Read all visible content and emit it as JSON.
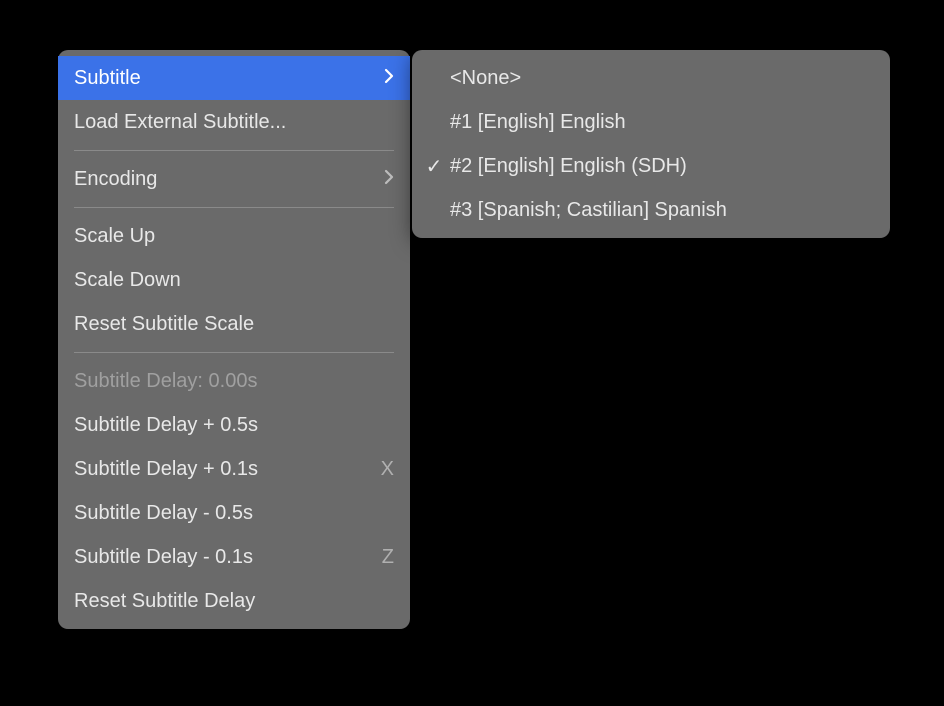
{
  "mainMenu": {
    "subtitle": "Subtitle",
    "loadExternal": "Load External Subtitle...",
    "encoding": "Encoding",
    "scaleUp": "Scale Up",
    "scaleDown": "Scale Down",
    "resetScale": "Reset Subtitle Scale",
    "delayStatus": "Subtitle Delay: 0.00s",
    "delayPlus05": "Subtitle Delay + 0.5s",
    "delayPlus01": "Subtitle Delay + 0.1s",
    "delayMinus05": "Subtitle Delay - 0.5s",
    "delayMinus01": "Subtitle Delay - 0.1s",
    "resetDelay": "Reset Subtitle Delay",
    "shortcutX": "X",
    "shortcutZ": "Z"
  },
  "submenu": {
    "none": "<None>",
    "track1": "#1 [English] English",
    "track2": "#2 [English] English (SDH)",
    "track3": "#3 [Spanish; Castilian] Spanish",
    "checkmark": "✓"
  }
}
